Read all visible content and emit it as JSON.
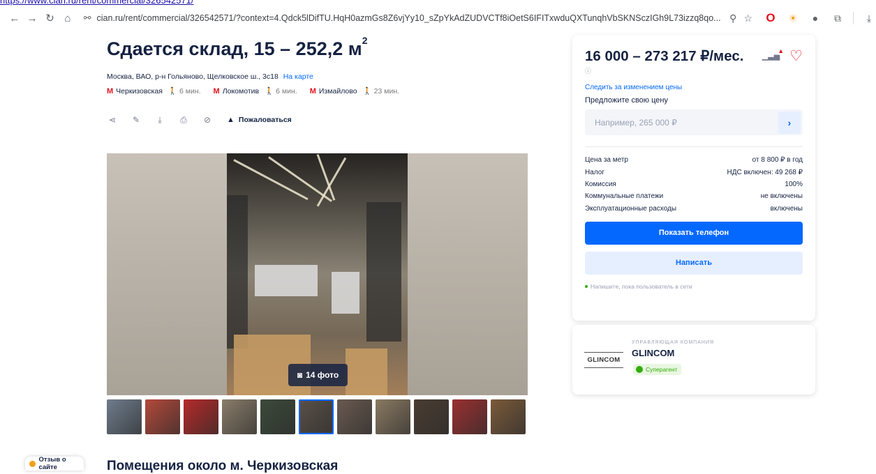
{
  "browser": {
    "top_link": "https://www.cian.ru/rent/commercial/326542571/",
    "url": "cian.ru/rent/commercial/326542571/?context=4.Qdck5lDifTU.HqH0azmGs8Z6vjYy10_sZpYkAdZUDVCTf8iOetS6IFITxwduQXTunqhVbSKNSczIGh9L73izzq8qo..."
  },
  "listing": {
    "title": "Сдается склад, 15 – 252,2 м",
    "title_sup": "2",
    "address": "Москва, ВАО, р-н Гольяново, Щелковское ш., 3с18",
    "map_link": "На карте",
    "metro": [
      {
        "name": "Черкизовская",
        "walk": "6 мин."
      },
      {
        "name": "Локомотив",
        "walk": "6 мин."
      },
      {
        "name": "Измайлово",
        "walk": "23 мин."
      }
    ],
    "complain": "Пожаловаться",
    "photo_count": "14 фото",
    "thumbnail_colors": [
      "#6f7c8c",
      "#b3493a",
      "#b42a2a",
      "#8a7d6a",
      "#3c4a3a",
      "#5a5048",
      "#6a5a50",
      "#8a7a62",
      "#4a3c32",
      "#9a3030",
      "#7a5a3a"
    ]
  },
  "section": {
    "title": "Помещения около м. Черкизовская"
  },
  "review": {
    "label": "Отзыв о сайте"
  },
  "price_card": {
    "price": "16 000 – 273 217 ₽/мес.",
    "follow": "Следить за изменением цены",
    "offer_label": "Предложите свою цену",
    "offer_placeholder": "Например, 265 000 ₽",
    "rows": [
      {
        "label": "Цена за метр",
        "value": "от 8 800 ₽ в год"
      },
      {
        "label": "Налог",
        "value": "НДС включен: 49 268 ₽"
      },
      {
        "label": "Комиссия",
        "value": "100%"
      },
      {
        "label": "Коммунальные платежи",
        "value": "не включены"
      },
      {
        "label": "Эксплуатационные расходы",
        "value": "включены"
      }
    ],
    "show_phone": "Показать телефон",
    "write": "Написать",
    "note": "Напишите, пока пользователь в сети"
  },
  "agent": {
    "logo_text": "GLINCOM",
    "type": "УПРАВЛЯЮЩАЯ КОМПАНИЯ",
    "name": "GLINCOM",
    "badge": "Суперагент"
  },
  "colors": {
    "accent": "#0468ff",
    "metro_red": "#e0141e",
    "text": "#152242",
    "success": "#34ac0a"
  }
}
